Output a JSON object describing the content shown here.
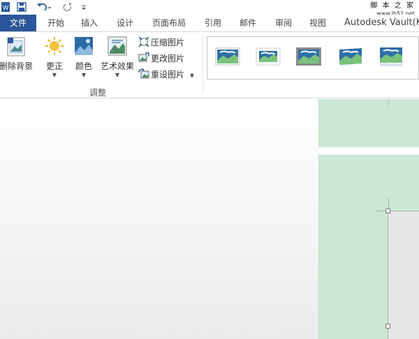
{
  "app": {
    "icon": "word-icon"
  },
  "quick_access": {
    "save_icon": "save-icon",
    "undo_icon": "undo-icon",
    "redo_icon": "redo-icon",
    "customize_icon": "customize-qat-icon"
  },
  "watermark": {
    "line1": "脚 本 之 家",
    "line2": "www.Jb51.net"
  },
  "tabs": {
    "file": "文件",
    "items": [
      "开始",
      "插入",
      "设计",
      "页面布局",
      "引用",
      "邮件",
      "审阅",
      "视图",
      "Autodesk Vault(K"
    ]
  },
  "ribbon": {
    "remove_background": "删除背景",
    "corrections": "更正",
    "color": "颜色",
    "artistic_effects": "艺术效果",
    "compress": "压缩图片",
    "change_picture": "更改图片",
    "reset_picture": "重设图片",
    "group_adjust": "调整"
  },
  "colors": {
    "file_tab": "#2b579a",
    "page_bg": "#cde8d2"
  }
}
